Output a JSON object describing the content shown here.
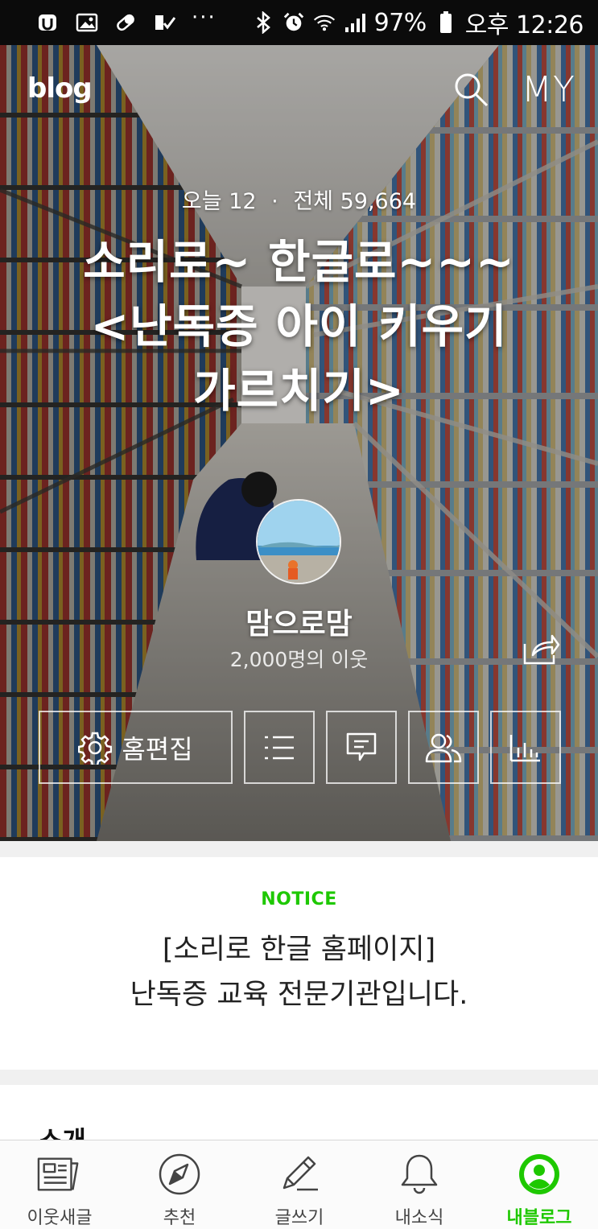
{
  "status_bar": {
    "overflow": "···",
    "battery": "97%",
    "time": "오후 12:26"
  },
  "header": {
    "logo": "blog",
    "my_label": "MY"
  },
  "profile": {
    "today_label": "오늘",
    "today_count": "12",
    "total_label": "전체",
    "total_count": "59,664",
    "title_line1": "소리로~ 한글로~~~",
    "title_line2": "<난독증 아이 키우기",
    "title_line3": "가르치기>",
    "nickname": "맘으로맘",
    "neighbors": "2,000명의 이웃",
    "edit_home_label": "홈편집"
  },
  "notice": {
    "label": "NOTICE",
    "line1": "[소리로 한글 홈페이지]",
    "line2": "난독증 교육 전문기관입니다."
  },
  "intro": {
    "title": "소개"
  },
  "bottom_nav": {
    "items": [
      {
        "label": "이웃새글",
        "icon": "newspaper-icon"
      },
      {
        "label": "추천",
        "icon": "compass-icon"
      },
      {
        "label": "글쓰기",
        "icon": "pencil-icon"
      },
      {
        "label": "내소식",
        "icon": "bell-icon"
      },
      {
        "label": "내블로그",
        "icon": "my-blog-icon"
      }
    ],
    "active_index": 4
  },
  "colors": {
    "accent": "#1ec800",
    "status_bar": "#0b0b0b"
  }
}
